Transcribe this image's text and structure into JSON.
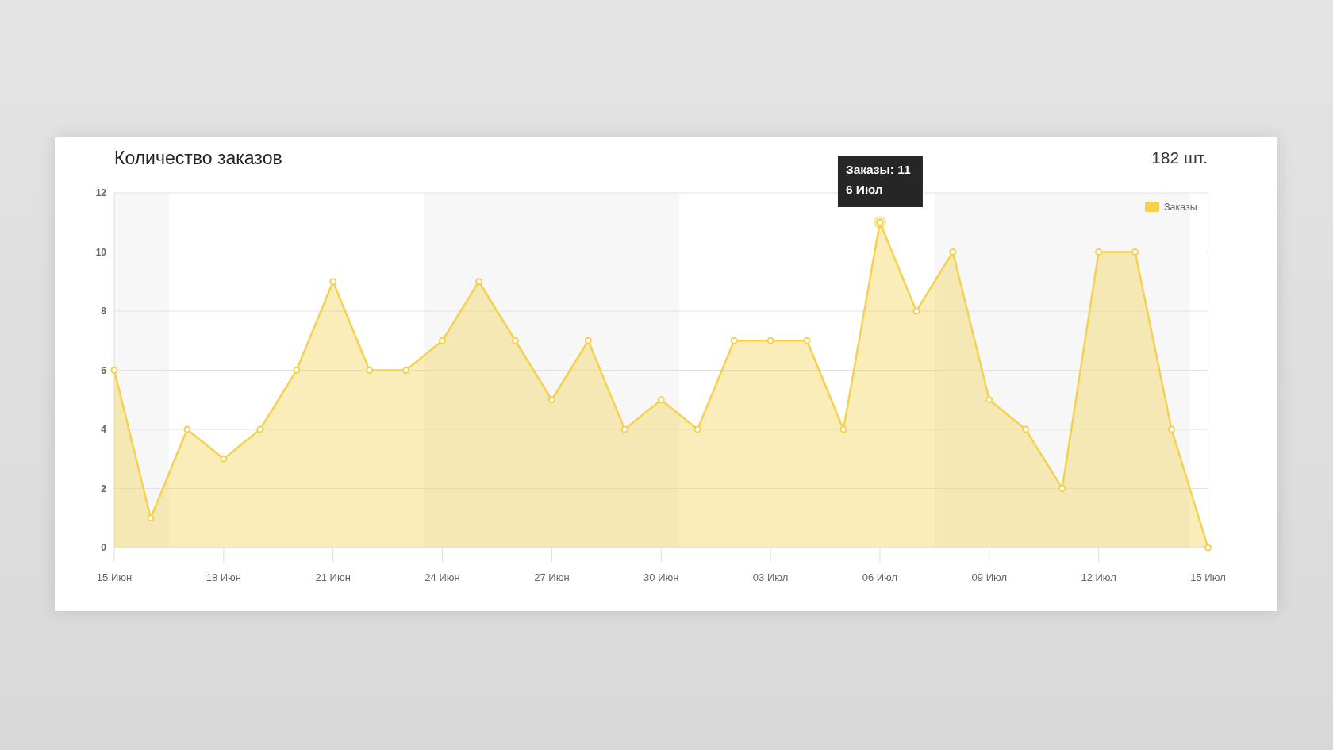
{
  "card": {
    "title": "Количество заказов",
    "total": "182 шт.",
    "chart_data": {
      "type": "area",
      "categories": [
        "15 Июн",
        null,
        null,
        "18 Июн",
        null,
        null,
        "21 Июн",
        null,
        null,
        "24 Июн",
        null,
        null,
        "27 Июн",
        null,
        null,
        "30 Июн",
        null,
        null,
        "03 Июл",
        null,
        null,
        "06 Июл",
        null,
        null,
        "09 Июл",
        null,
        null,
        "12 Июл",
        null,
        null,
        "15 Июл"
      ],
      "series": [
        {
          "name": "Заказы",
          "color": "#f5d14f",
          "values": [
            6,
            1,
            4,
            3,
            4,
            6,
            9,
            6,
            6,
            7,
            9,
            7,
            5,
            7,
            4,
            5,
            4,
            7,
            7,
            7,
            4,
            11,
            8,
            10,
            5,
            4,
            2,
            10,
            10,
            4,
            0
          ]
        }
      ],
      "ylim": [
        0,
        12
      ],
      "yticks": [
        0,
        2,
        4,
        6,
        8,
        10,
        12
      ],
      "grid": true,
      "annotations": [
        "Заказы: 11"
      ]
    },
    "tooltip": {
      "date": "6 Июл"
    }
  }
}
